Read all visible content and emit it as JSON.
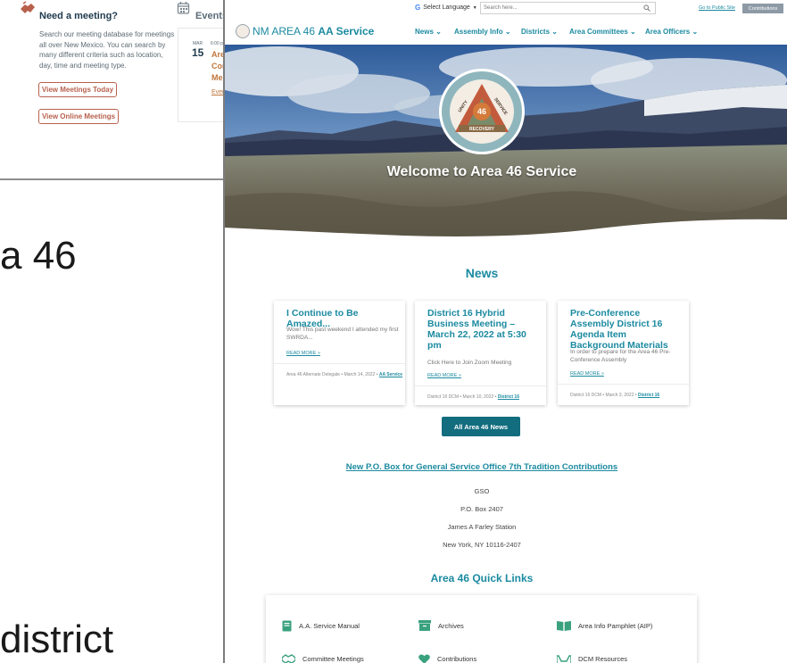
{
  "background_page": {
    "meeting": {
      "title": "Need a meeting?",
      "description": "Search our meeting database for meetings all over New Mexico. You can search by many different criteria such as location, day, time and meeting type.",
      "button_today": "View Meetings Today",
      "button_online": "View Online Meetings"
    },
    "events": {
      "title": "Events",
      "month": "MAR",
      "time": "6:00 p",
      "day": "15",
      "lines": [
        "Are",
        "Con",
        "Me"
      ],
      "link": "Even"
    },
    "large_text": [
      "a 46",
      "district"
    ]
  },
  "site": {
    "topbar": {
      "translate_label": "Select Language",
      "translate_arrow": "▼",
      "search_placeholder": "Search here...",
      "public_link": "Go to Public Site",
      "contributions": "Contributions"
    },
    "logo": {
      "prefix": "NM AREA 46",
      "bold": "AA Service"
    },
    "nav": [
      "News",
      "Assembly Info",
      "Districts",
      "Area Committees",
      "Area Officers"
    ],
    "hero": {
      "title": "Welcome to Area 46 Service",
      "seal_words": [
        "UNITY",
        "SERVICE",
        "RECOVERY",
        "46",
        "NM"
      ]
    },
    "news_heading": "News",
    "news": [
      {
        "title": "I Continue to Be Amazed...",
        "excerpt": "Wow! This past weekend I attended my first SWRDA...",
        "read_more": "READ MORE »",
        "meta": "Area 46 Alternate Delegate  •  March 14, 2022  •",
        "category": "AA Service"
      },
      {
        "title": "District 16 Hybrid Business Meeting – March 22, 2022 at 5:30 pm",
        "excerpt": "Click Here to Join Zoom Meeting",
        "read_more": "READ MORE »",
        "meta": "District 16 DCM  •  March 10, 2022  •",
        "category": "District 16"
      },
      {
        "title": "Pre-Conference Assembly District 16 Agenda Item Background Materials",
        "excerpt": "In order to prepare for the Area 46 Pre-Conference Assembly",
        "read_more": "READ MORE »",
        "meta": "District 16 DCM  •  March 3, 2022  •",
        "category": "District 16"
      }
    ],
    "all_news_button": "All Area 46 News",
    "po_box": {
      "title": "New P.O. Box for General Service Office 7th Tradition Contributions",
      "address": [
        "GSO",
        "P.O. Box 2407",
        "James A Farley Station",
        "New York, NY 10116-2407"
      ]
    },
    "quick_links": {
      "title": "Area 46 Quick Links",
      "items": [
        {
          "label": "A.A. Service Manual",
          "icon": "book-icon"
        },
        {
          "label": "Archives",
          "icon": "archive-icon"
        },
        {
          "label": "Area Info Pamphlet (AIP)",
          "icon": "open-book-icon"
        },
        {
          "label": "Committee Meetings",
          "icon": "handshake-icon"
        },
        {
          "label": "Contributions",
          "icon": "heart-icon"
        },
        {
          "label": "DCM Resources",
          "icon": "hands-icon"
        }
      ]
    },
    "colors": {
      "teal": "#1b8aa0",
      "button": "#126d7f",
      "accent": "#b7614d",
      "quick_link_icon": "#3aa17e"
    }
  }
}
